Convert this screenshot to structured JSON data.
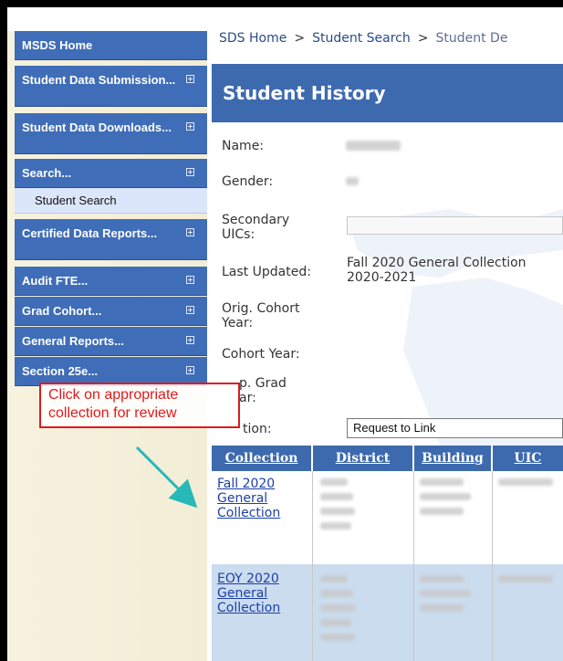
{
  "app": {
    "title": "MSDS",
    "top_link": "Ho"
  },
  "sidebar": {
    "items": [
      {
        "label": "MSDS Home",
        "expandable": false
      },
      {
        "label": "Student Data Submission...",
        "expandable": true
      },
      {
        "label": "Student Data Downloads...",
        "expandable": true
      },
      {
        "label": "Search...",
        "expandable": true
      },
      {
        "label": "Student Search",
        "expandable": false,
        "sub": true
      },
      {
        "label": "Certified Data Reports...",
        "expandable": true
      },
      {
        "label": "Audit FTE...",
        "expandable": true
      },
      {
        "label": "Grad Cohort...",
        "expandable": true
      },
      {
        "label": "General Reports...",
        "expandable": true
      },
      {
        "label": "Section 25e...",
        "expandable": true
      }
    ]
  },
  "breadcrumb": {
    "home": "SDS Home",
    "sep": ">",
    "search": "Student Search",
    "current": "Student De"
  },
  "page": {
    "title": "Student History"
  },
  "fields": {
    "name_label": "Name:",
    "gender_label": "Gender:",
    "secondary_uics_label": "Secondary UICs:",
    "last_updated_label": "Last Updated:",
    "last_updated_value": "Fall 2020 General Collection 2020-2021",
    "orig_cohort_label": "Orig. Cohort Year:",
    "cohort_year_label": "Cohort Year:",
    "exp_grad_label": "p. Grad ar:",
    "action_label": "tion:",
    "action_value": "Request to Link"
  },
  "table": {
    "headers": [
      "Collection",
      "District",
      "Building",
      "UIC"
    ],
    "rows": [
      {
        "collection": "Fall 2020 General Collection"
      },
      {
        "collection": "EOY 2020 General Collection"
      }
    ]
  },
  "annotation": {
    "text": "Click on appropriate collection for review"
  },
  "colors": {
    "nav": "#3f6db8",
    "header": "#3d6aae",
    "callout": "#e0191d",
    "arrow": "#27b8b8"
  }
}
